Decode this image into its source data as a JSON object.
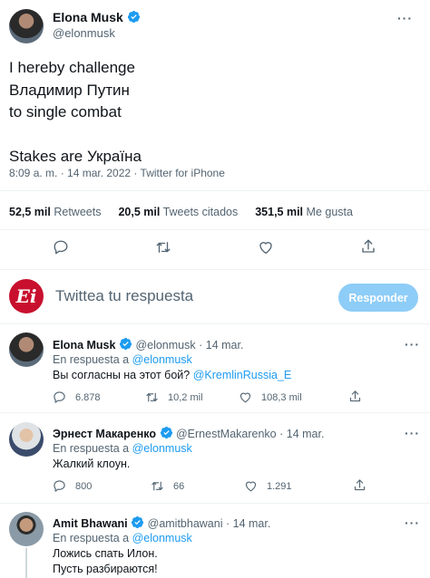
{
  "main_tweet": {
    "author_name": "Elona Musk",
    "handle": "@elonmusk",
    "lines": [
      "I hereby challenge",
      "Владимир Путин",
      "to single combat",
      "",
      "Stakes are Україна"
    ],
    "meta": "8:09 a. m. · 14 mar. 2022 · Twitter for iPhone",
    "stats": {
      "retweets_count": "52,5 mil",
      "retweets_label": "Retweets",
      "quotes_count": "20,5 mil",
      "quotes_label": "Tweets citados",
      "likes_count": "351,5 mil",
      "likes_label": "Me gusta"
    }
  },
  "composer": {
    "logo_text": "Ei",
    "placeholder": "Twittea tu respuesta",
    "reply_button": "Responder"
  },
  "replies": [
    {
      "author_name": "Elona Musk",
      "handle": "@elonmusk",
      "date": "· 14 mar.",
      "reply_prefix": "En respuesta a",
      "reply_to": "@elonmusk",
      "text": "Вы согласны на этот бой?",
      "mention": "@KremlinRussia_E",
      "comments": "6.878",
      "retweets": "10,2 mil",
      "likes": "108,3 mil"
    },
    {
      "author_name": "Эрнест Макаренко",
      "handle": "@ErnestMakarenko",
      "date": "· 14 mar.",
      "reply_prefix": "En respuesta a",
      "reply_to": "@elonmusk",
      "text": "Жалкий клоун.",
      "comments": "800",
      "retweets": "66",
      "likes": "1.291"
    },
    {
      "author_name": "Amit Bhawani",
      "handle": "@amitbhawani",
      "date": "· 14 mar.",
      "reply_prefix": "En respuesta a",
      "reply_to": "@elonmusk",
      "text_line1": "Ложись спать Илон.",
      "text_line2": "Пусть разбираются!"
    }
  ],
  "colors": {
    "accent": "#1d9bf0",
    "verified": "#1d9bf0",
    "button_disabled": "#8ecdf8",
    "muted": "#536471",
    "divider": "#eff3f4",
    "logo_red": "#c8102e"
  }
}
